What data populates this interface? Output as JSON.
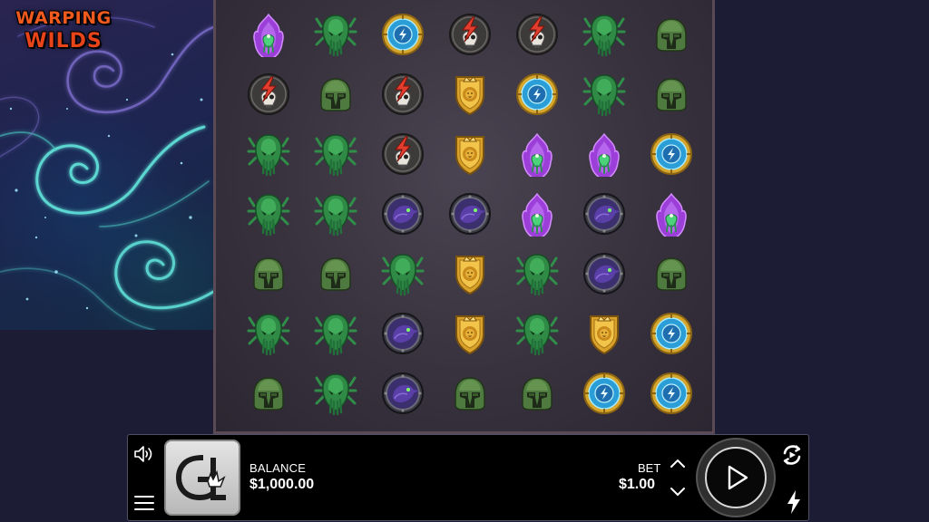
{
  "game": {
    "title_line1": "WARPING",
    "title_line2": "WILDS"
  },
  "reels": {
    "columns": 7,
    "rows": 7,
    "grid": [
      [
        "wild-crystal",
        "green-spider",
        "blue-rune",
        "red-skull",
        "red-skull",
        "green-spider",
        "green-helmet"
      ],
      [
        "red-skull",
        "green-helmet",
        "red-skull",
        "gold-lion-shield",
        "blue-rune",
        "green-spider",
        "green-helmet"
      ],
      [
        "green-spider",
        "green-spider",
        "red-skull",
        "gold-lion-shield",
        "wild-crystal",
        "wild-crystal",
        "blue-rune"
      ],
      [
        "green-spider",
        "green-spider",
        "purple-raven",
        "purple-raven",
        "wild-crystal",
        "purple-raven",
        "wild-crystal"
      ],
      [
        "green-helmet",
        "green-helmet",
        "green-spider",
        "gold-lion-shield",
        "green-spider",
        "purple-raven",
        "green-helmet"
      ],
      [
        "green-spider",
        "green-spider",
        "purple-raven",
        "gold-lion-shield",
        "green-spider",
        "gold-lion-shield",
        "blue-rune"
      ],
      [
        "green-helmet",
        "green-spider",
        "purple-raven",
        "green-helmet",
        "green-helmet",
        "blue-rune",
        "blue-rune"
      ]
    ]
  },
  "controls": {
    "balance_label": "BALANCE",
    "balance_value": "$1,000.00",
    "bet_label": "BET",
    "bet_value": "$1.00",
    "icons": {
      "sound": "speaker-icon",
      "menu": "hamburger-menu-icon",
      "bet_up": "chevron-up-icon",
      "bet_down": "chevron-down-icon",
      "spin": "play-icon",
      "autoplay": "autoplay-icon",
      "turbo": "lightning-icon"
    }
  },
  "colors": {
    "background": "#1c1c34",
    "bar": "#000000",
    "accent_teal": "#5fe0d8",
    "logo_orange": "#f05a1e"
  }
}
